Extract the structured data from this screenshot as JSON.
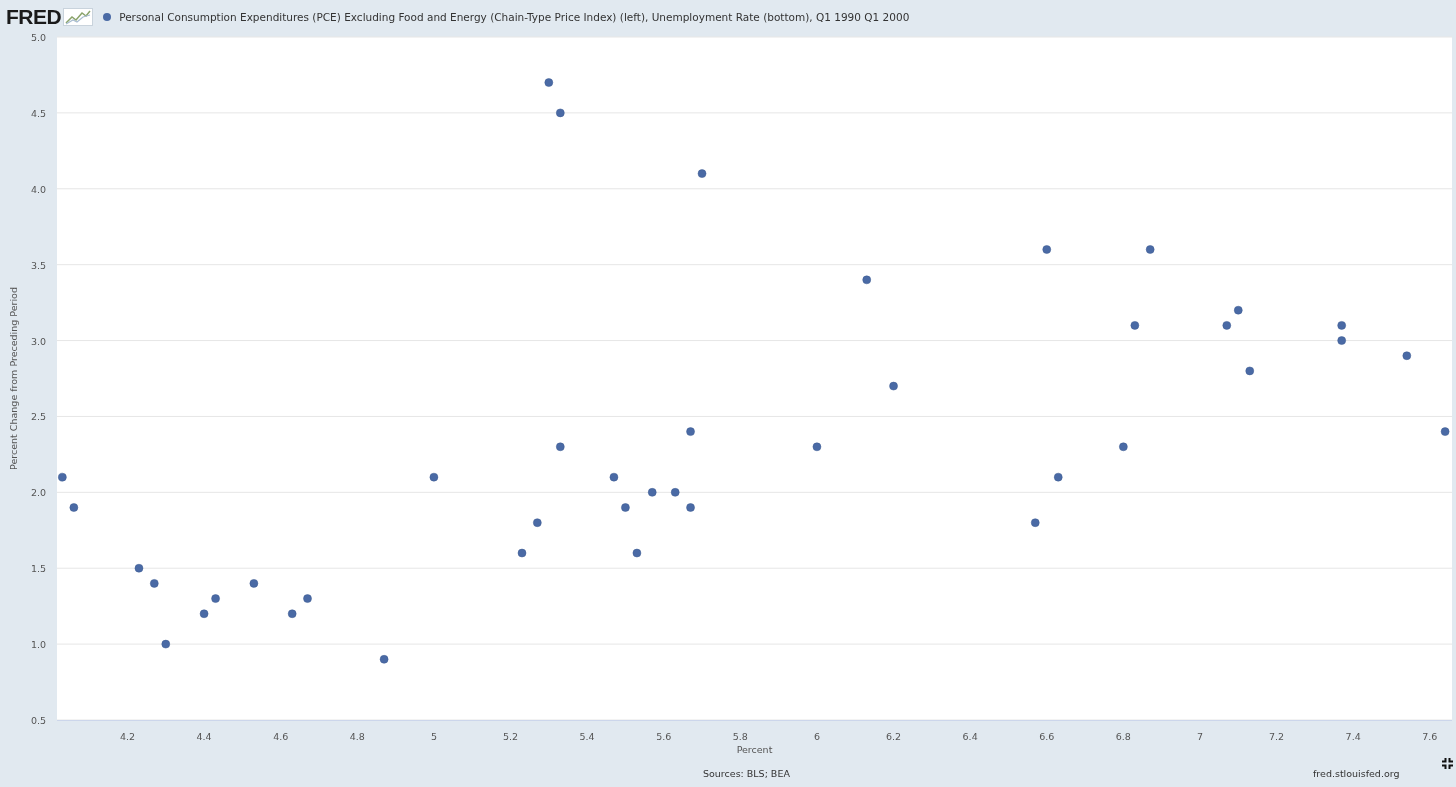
{
  "header": {
    "logo": "FRED"
  },
  "chart": {
    "chart_data": {
      "type": "scatter",
      "xlabel": "Percent",
      "ylabel": "Percent Change from Preceding Period",
      "x": [
        4.03,
        4.06,
        4.23,
        4.27,
        4.3,
        4.4,
        4.43,
        4.53,
        4.63,
        4.67,
        4.87,
        5.0,
        5.23,
        5.27,
        5.3,
        5.33,
        5.33,
        5.47,
        5.5,
        5.53,
        5.57,
        5.63,
        5.67,
        5.67,
        5.7,
        6.0,
        6.13,
        6.2,
        6.57,
        6.6,
        6.63,
        6.8,
        6.83,
        6.87,
        7.07,
        7.1,
        7.13,
        7.37,
        7.37,
        7.54,
        7.64
      ],
      "series": [
        {
          "name": "Personal Consumption Expenditures (PCE) Excluding Food and Energy (Chain-Type Price Index) (left), Unemployment Rate (bottom), Q1 1990 Q1 2000",
          "color": "#4a6aa5",
          "values": [
            2.1,
            1.9,
            1.5,
            1.4,
            1.0,
            1.2,
            1.3,
            1.4,
            1.2,
            1.3,
            0.9,
            2.1,
            1.6,
            1.8,
            4.7,
            4.5,
            2.3,
            2.1,
            1.9,
            1.6,
            2.0,
            2.0,
            2.4,
            1.9,
            4.1,
            2.3,
            3.4,
            2.7,
            1.8,
            3.6,
            2.1,
            2.3,
            3.1,
            3.6,
            3.1,
            3.2,
            2.8,
            3.1,
            3.0,
            2.9,
            2.4
          ]
        }
      ],
      "grid": true,
      "xlim": [
        4.016,
        7.658
      ],
      "ylim": [
        0.5,
        5.0
      ],
      "xticks": [
        4.2,
        4.4,
        4.6,
        4.8,
        5,
        5.2,
        5.4,
        5.6,
        5.8,
        6,
        6.2,
        6.4,
        6.6,
        6.8,
        7,
        7.2,
        7.4,
        7.6
      ],
      "yticks": [
        {
          "value": 0.5,
          "label": "0.5"
        },
        {
          "value": 1,
          "label": "1.0"
        },
        {
          "value": 1.5,
          "label": "1.5"
        },
        {
          "value": 2,
          "label": "2.0"
        },
        {
          "value": 2.5,
          "label": "2.5"
        },
        {
          "value": 3,
          "label": "3.0"
        },
        {
          "value": 3.5,
          "label": "3.5"
        },
        {
          "value": 4,
          "label": "4.0"
        },
        {
          "value": 4.5,
          "label": "4.5"
        },
        {
          "value": 5,
          "label": "5.0"
        }
      ]
    }
  },
  "footer": {
    "sources": "Sources: BLS; BEA",
    "site": "fred.stlouisfed.org"
  }
}
